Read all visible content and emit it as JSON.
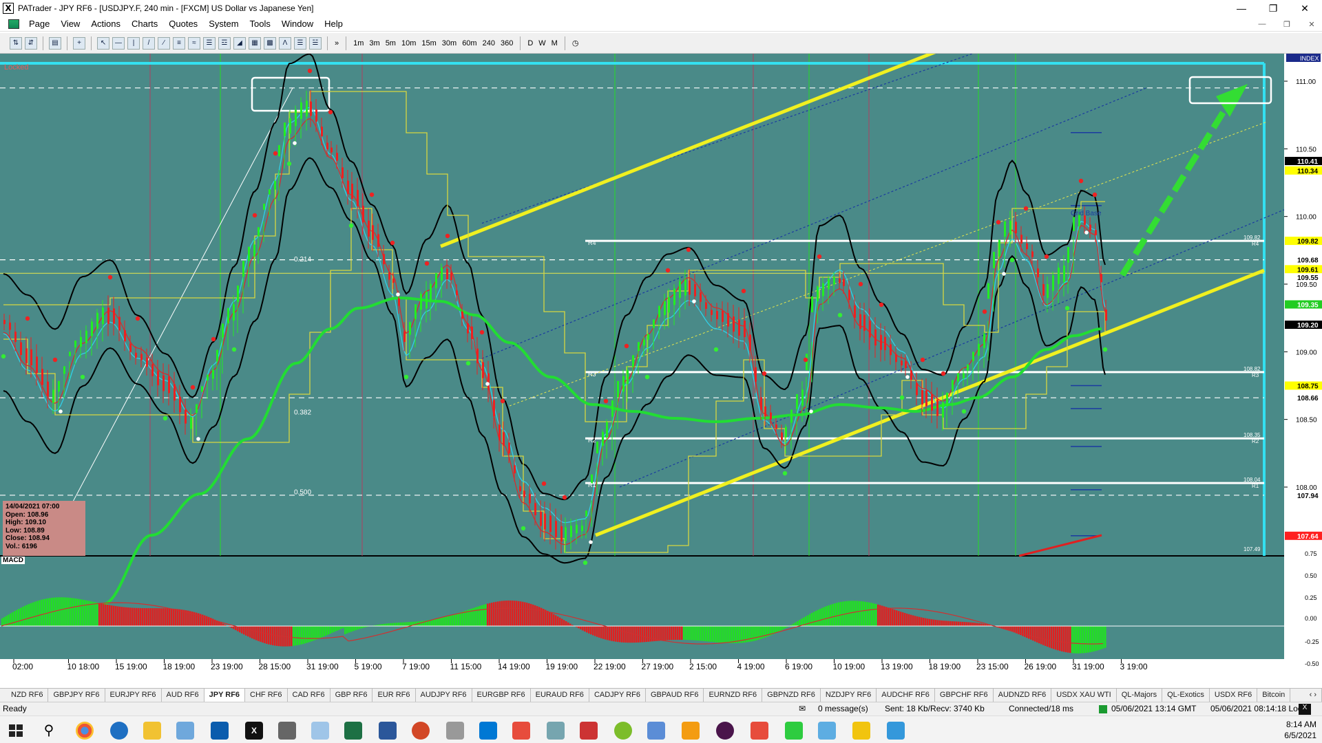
{
  "window": {
    "title": "PATrader - JPY RF6 - [USDJPY.F, 240 min - [FXCM] US Dollar vs Japanese Yen]"
  },
  "menu": {
    "items": [
      "Page",
      "View",
      "Actions",
      "Charts",
      "Quotes",
      "System",
      "Tools",
      "Window",
      "Help"
    ]
  },
  "toolbar": {
    "timeframes": [
      "1m",
      "3m",
      "5m",
      "10m",
      "15m",
      "30m",
      "60m",
      "240",
      "360"
    ],
    "periods": [
      "D",
      "W",
      "M"
    ]
  },
  "chart": {
    "locked_label": "Locked",
    "index_label": "INDEX",
    "fib_labels": [
      "0.214",
      "0.382",
      "0.500"
    ],
    "pivot_labels": [
      "R4",
      "R3",
      "R2",
      "R1"
    ],
    "grid_label": "Grid Base",
    "price_axis": [
      "111.00",
      "110.50",
      "110.00",
      "109.50",
      "109.00",
      "108.50",
      "108.00"
    ],
    "price_tags": [
      {
        "text": "110.41",
        "bg": "#000000",
        "fg": "#ffffff"
      },
      {
        "text": "110.34",
        "bg": "#ffff00",
        "fg": "#000000"
      },
      {
        "text": "109.82",
        "bg": "#ffff00",
        "fg": "#000000"
      },
      {
        "text": "109.68",
        "bg": "#ffffff",
        "fg": "#000000"
      },
      {
        "text": "109.61",
        "bg": "#ffff00",
        "fg": "#000000"
      },
      {
        "text": "109.55",
        "bg": "#ffffff",
        "fg": "#000000"
      },
      {
        "text": "109.35",
        "bg": "#22cc22",
        "fg": "#ffffff"
      },
      {
        "text": "109.20",
        "bg": "#000000",
        "fg": "#ffffff"
      },
      {
        "text": "108.75",
        "bg": "#ffff00",
        "fg": "#000000"
      },
      {
        "text": "108.66",
        "bg": "#ffffff",
        "fg": "#000000"
      },
      {
        "text": "107.94",
        "bg": "#ffffff",
        "fg": "#000000"
      },
      {
        "text": "107.64",
        "bg": "#ff2020",
        "fg": "#ffffff"
      }
    ],
    "level_labels": [
      "109.82",
      "108.82",
      "108.35",
      "108.04",
      "107.49"
    ],
    "macd_axis": [
      "0.75",
      "0.50",
      "0.25",
      "0.00",
      "-0.25",
      "-0.50"
    ],
    "macd_label": "MACD",
    "info_box": {
      "date": "14/04/2021 07:00",
      "open": "Open: 108.96",
      "high": "High: 109.10",
      "low": "Low: 108.89",
      "close": "Close: 108.94",
      "vol": "Vol.: 6196"
    },
    "time_axis": [
      "02:00",
      "10 18:00",
      "15 19:00",
      "18 19:00",
      "23 19:00",
      "28 15:00",
      "31 19:00",
      "5 19:00",
      "7 19:00",
      "11 15:00",
      "14 19:00",
      "19 19:00",
      "22 19:00",
      "27 19:00",
      "2 15:00",
      "4 19:00",
      "6 19:00",
      "10 19:00",
      "13 19:00",
      "18 19:00",
      "23 15:00",
      "26 19:00",
      "31 19:00",
      "3 19:00"
    ]
  },
  "tabs": [
    "NZD RF6",
    "GBPJPY RF6",
    "EURJPY RF6",
    "AUD RF6",
    "JPY RF6",
    "CHF RF6",
    "CAD RF6",
    "GBP RF6",
    "EUR RF6",
    "AUDJPY RF6",
    "EURGBP RF6",
    "EURAUD RF6",
    "CADJPY RF6",
    "GBPAUD RF6",
    "EURNZD RF6",
    "GBPNZD RF6",
    "NZDJPY RF6",
    "AUDCHF RF6",
    "GBPCHF RF6",
    "AUDNZD RF6",
    "USDX XAU WTI",
    "QL-Majors",
    "QL-Exotics",
    "USDX RF6",
    "Bitcoin"
  ],
  "active_tab": "JPY RF6",
  "status": {
    "ready": "Ready",
    "messages": "0 message(s)",
    "traffic": "Sent: 18 Kb/Recv: 3740 Kb",
    "connection": "Connected/18 ms",
    "gmt": "05/06/2021 13:14 GMT",
    "local": "05/06/2021 08:14:18 Local"
  },
  "taskbar": {
    "time": "8:14 AM",
    "date": "6/5/2021"
  }
}
